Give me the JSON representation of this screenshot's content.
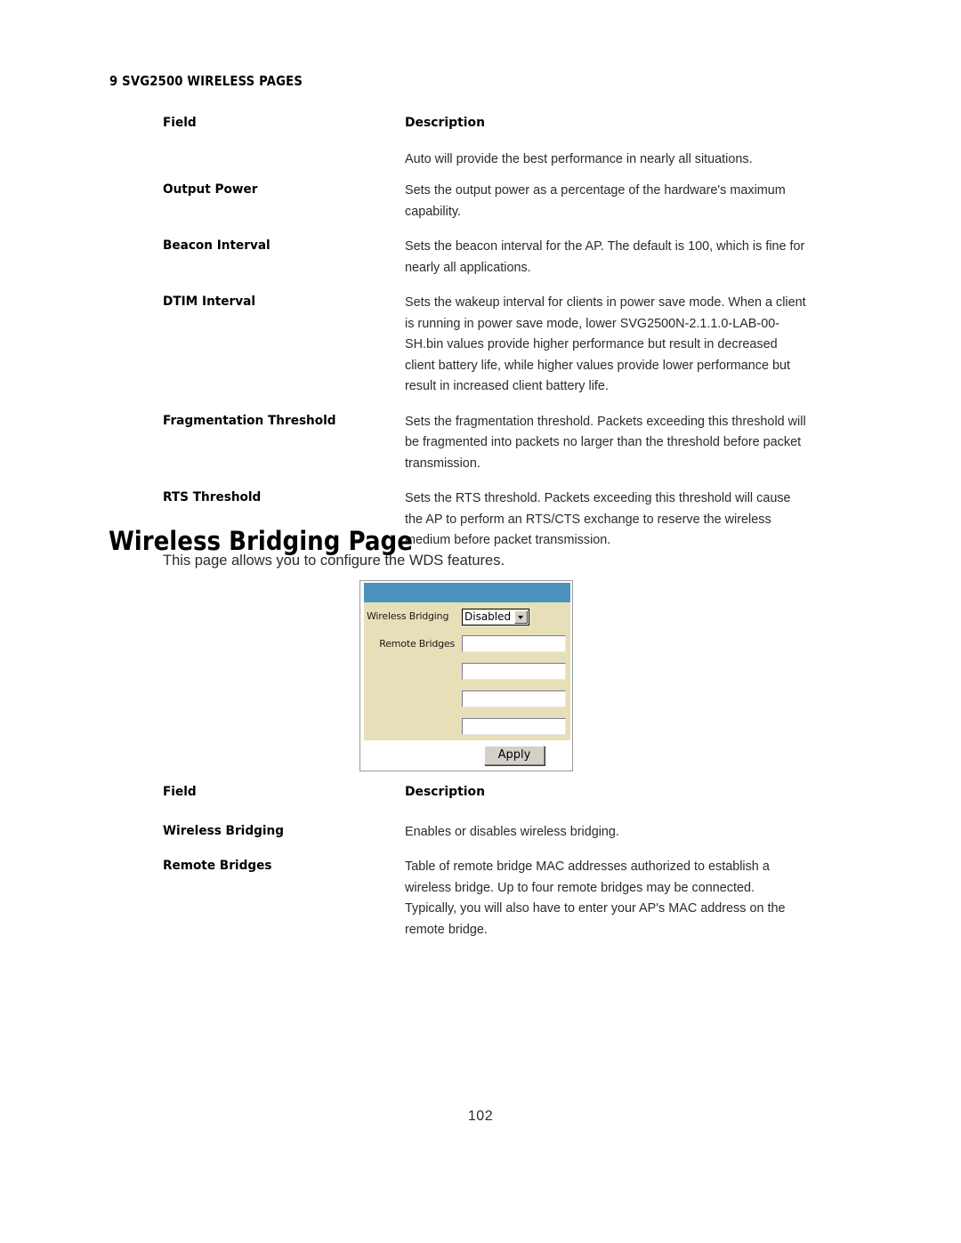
{
  "running_head": "9 SVG2500 WIRELESS PAGES",
  "table_top": {
    "header": {
      "field": "Field",
      "description": "Description"
    },
    "rows": [
      {
        "field": "",
        "description": "Auto will provide the best performance in nearly all situations."
      },
      {
        "field": "Output Power",
        "description": "Sets the output power as a percentage of the hardware's maximum capability."
      },
      {
        "field": "Beacon Interval",
        "description": "Sets the beacon interval for the AP. The default is 100, which is fine for nearly all applications."
      },
      {
        "field": "DTIM Interval",
        "description": "Sets the wakeup interval for clients in power save mode. When a client is running in power save mode, lower SVG2500N-2.1.1.0-LAB-00-SH.bin values provide higher performance but result in decreased client battery life, while higher values provide lower performance but result in increased client battery life."
      },
      {
        "field": "Fragmentation Threshold",
        "description": "Sets the fragmentation threshold. Packets exceeding this threshold will be fragmented into packets no larger than the threshold before packet transmission."
      },
      {
        "field": "RTS Threshold",
        "description": "Sets the RTS threshold. Packets exceeding this threshold will cause the AP to perform an RTS/CTS exchange to reserve the wireless medium before packet transmission."
      }
    ]
  },
  "section": {
    "heading": "Wireless Bridging Page",
    "intro": "This page allows you to configure the WDS features."
  },
  "router_screenshot": {
    "titlebar_color": "#4b92bd",
    "label_cell_color": "#e6dfb8",
    "rows": [
      {
        "label": "Wireless Bridging",
        "control": "select",
        "value": "Disabled"
      },
      {
        "label": "Remote Bridges",
        "control": "text",
        "value": ""
      },
      {
        "label": "",
        "control": "text",
        "value": ""
      },
      {
        "label": "",
        "control": "text",
        "value": ""
      },
      {
        "label": "",
        "control": "text",
        "value": ""
      }
    ],
    "apply_label": "Apply"
  },
  "table_bottom": {
    "header": {
      "field": "Field",
      "description": "Description"
    },
    "rows": [
      {
        "field": "Wireless Bridging",
        "description": "Enables or disables wireless bridging."
      },
      {
        "field": "Remote Bridges",
        "description": "Table of remote bridge MAC addresses authorized to establish a wireless bridge. Up to four remote bridges may be connected. Typically, you will also have to enter your AP's MAC address on the remote bridge."
      }
    ]
  },
  "page_number": "102"
}
